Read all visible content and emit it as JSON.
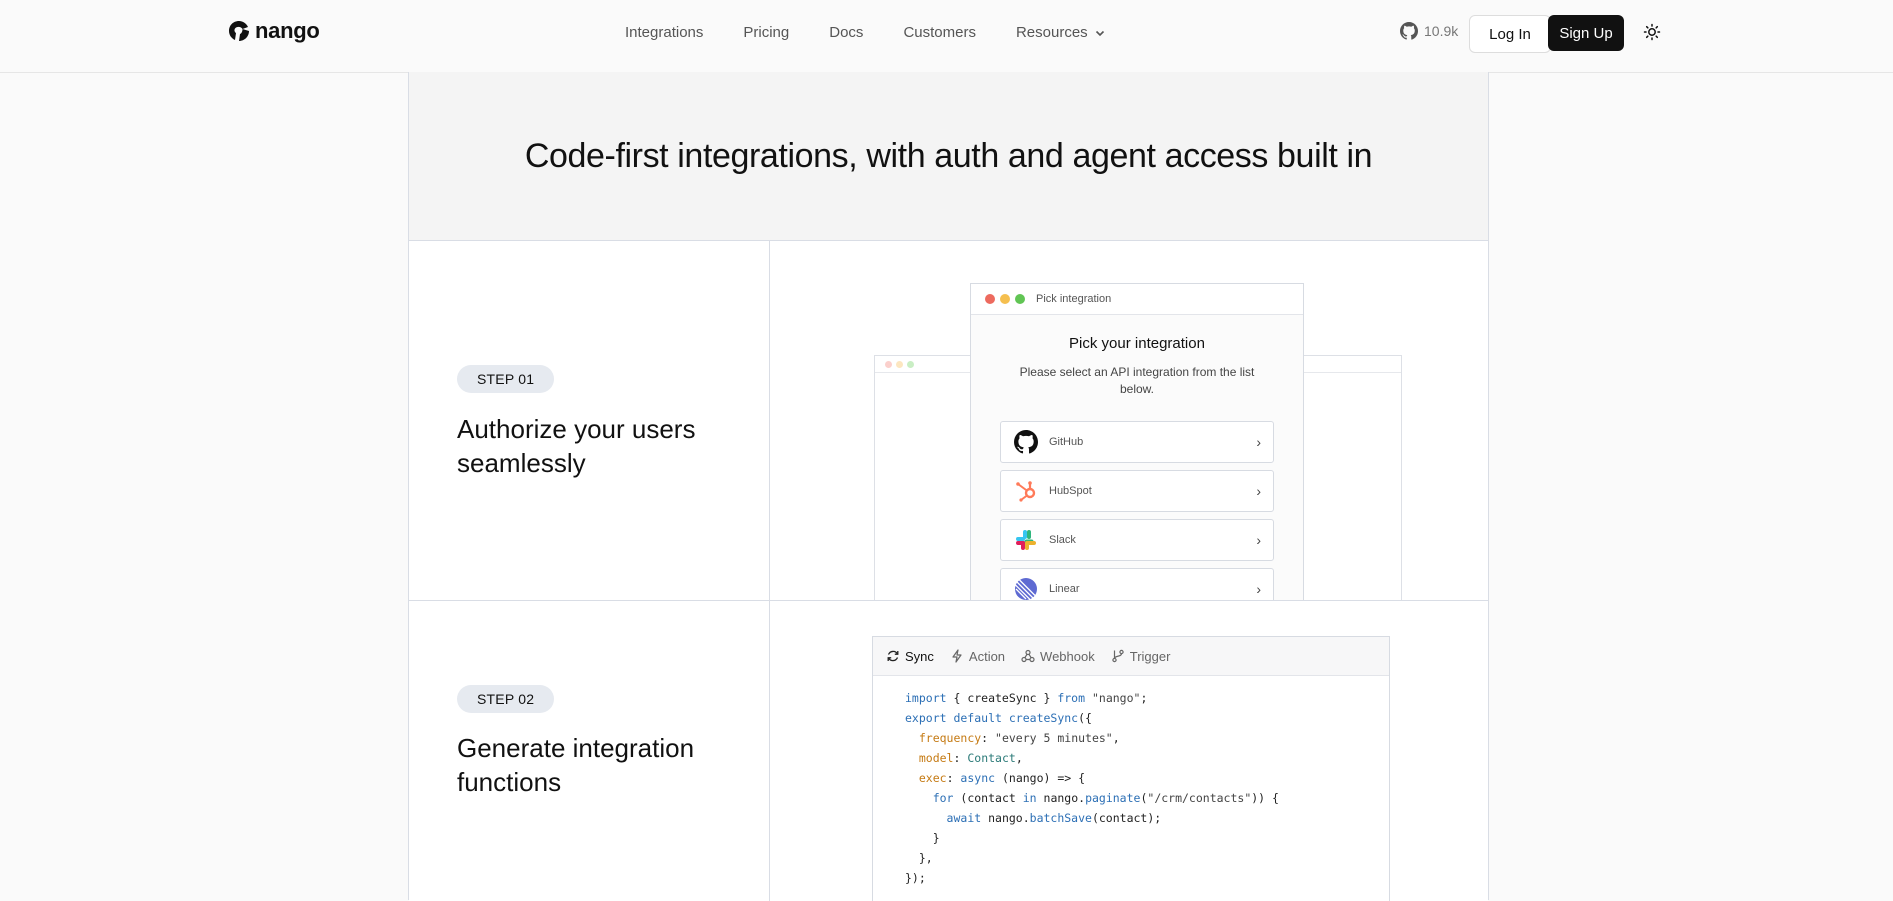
{
  "header": {
    "logo_text": "nango",
    "nav": [
      "Integrations",
      "Pricing",
      "Docs",
      "Customers",
      "Resources"
    ],
    "github_stars": "10.9k",
    "login_label": "Log In",
    "signup_label": "Sign Up"
  },
  "hero": {
    "title": "Code-first integrations, with auth and agent access built in"
  },
  "steps": [
    {
      "badge": "STEP 01",
      "title": "Authorize your users seamlessly"
    },
    {
      "badge": "STEP 02",
      "title": "Generate integration functions"
    }
  ],
  "picker": {
    "window_title": "Pick integration",
    "title": "Pick your integration",
    "subtitle": "Please select an API integration from the list below.",
    "items": [
      "GitHub",
      "HubSpot",
      "Slack",
      "Linear"
    ]
  },
  "code_panel": {
    "tabs": [
      "Sync",
      "Action",
      "Webhook",
      "Trigger"
    ],
    "active_tab": "Sync"
  },
  "colors": {
    "dot_red": "#ed6a5e",
    "dot_yellow": "#f5bf4f",
    "dot_green": "#61c554"
  }
}
